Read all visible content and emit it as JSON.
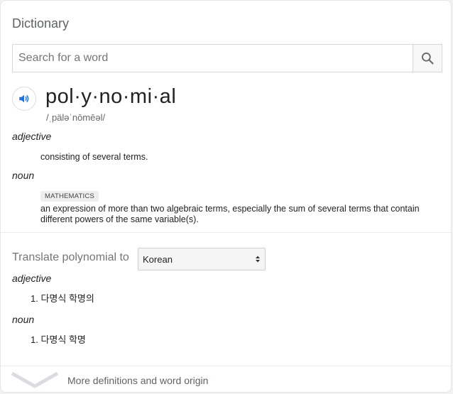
{
  "header": {
    "title": "Dictionary"
  },
  "search": {
    "placeholder": "Search for a word",
    "button_icon": "search-icon"
  },
  "entry": {
    "audio_icon": "speaker-icon",
    "headword": "pol·y·no·mi·al",
    "phonetic": "/ˌpäləˈnōmēəl/",
    "senses": [
      {
        "pos": "adjective",
        "definition": "consisting of several terms."
      },
      {
        "pos": "noun",
        "label": "MATHEMATICS",
        "definition": "an expression of more than two algebraic terms, especially the sum of several terms that contain different powers of the same variable(s)."
      }
    ]
  },
  "translate": {
    "label": "Translate polynomial to",
    "selected_language": "Korean",
    "groups": [
      {
        "pos": "adjective",
        "items": [
          "1. 다명식 학명의"
        ]
      },
      {
        "pos": "noun",
        "items": [
          "1. 다명식 학명"
        ]
      }
    ]
  },
  "footer": {
    "more_label": "More definitions and word origin",
    "icon": "chevron-down-icon"
  },
  "colors": {
    "accent": "#1a73e8",
    "text": "#222222",
    "muted": "#5f6368"
  }
}
